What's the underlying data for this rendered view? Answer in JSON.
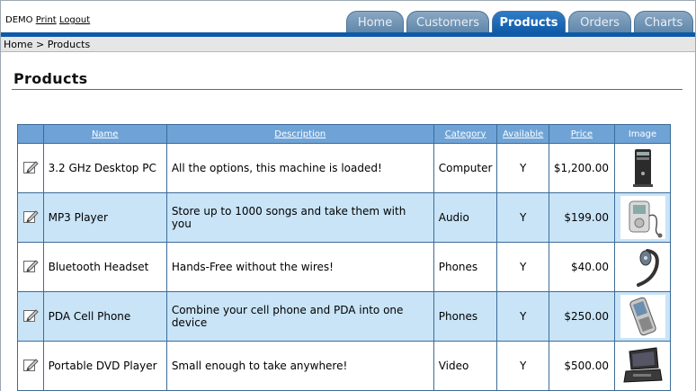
{
  "header": {
    "user": "DEMO",
    "print_link": "Print",
    "logout_link": "Logout"
  },
  "tabs": [
    {
      "label": "Home",
      "active": false
    },
    {
      "label": "Customers",
      "active": false
    },
    {
      "label": "Products",
      "active": true
    },
    {
      "label": "Orders",
      "active": false
    },
    {
      "label": "Charts",
      "active": false
    }
  ],
  "breadcrumb": {
    "home": "Home",
    "separator": " > ",
    "current": "Products"
  },
  "page_title": "Products",
  "table": {
    "columns": [
      "Name",
      "Description",
      "Category",
      "Available",
      "Price",
      "Image"
    ],
    "rows": [
      {
        "name": "3.2 GHz Desktop PC",
        "description": "All the options, this machine is loaded!",
        "category": "Computer",
        "available": "Y",
        "price": "$1,200.00",
        "image": "desktop-pc-image"
      },
      {
        "name": "MP3 Player",
        "description": "Store up to 1000 songs and take them with you",
        "category": "Audio",
        "available": "Y",
        "price": "$199.00",
        "image": "mp3-player-image"
      },
      {
        "name": "Bluetooth Headset",
        "description": "Hands-Free without the wires!",
        "category": "Phones",
        "available": "Y",
        "price": "$40.00",
        "image": "bluetooth-headset-image"
      },
      {
        "name": "PDA Cell Phone",
        "description": "Combine your cell phone and PDA into one device",
        "category": "Phones",
        "available": "Y",
        "price": "$250.00",
        "image": "pda-phone-image"
      },
      {
        "name": "Portable DVD Player",
        "description": "Small enough to take anywhere!",
        "category": "Video",
        "available": "Y",
        "price": "$500.00",
        "image": "dvd-player-image"
      }
    ]
  },
  "colors": {
    "tab_active": "#0f5aa7",
    "tab_inactive": "#6f93b5",
    "header_row": "#6fa3d6",
    "alt_row": "#c9e4f7",
    "border": "#3c6c98"
  }
}
